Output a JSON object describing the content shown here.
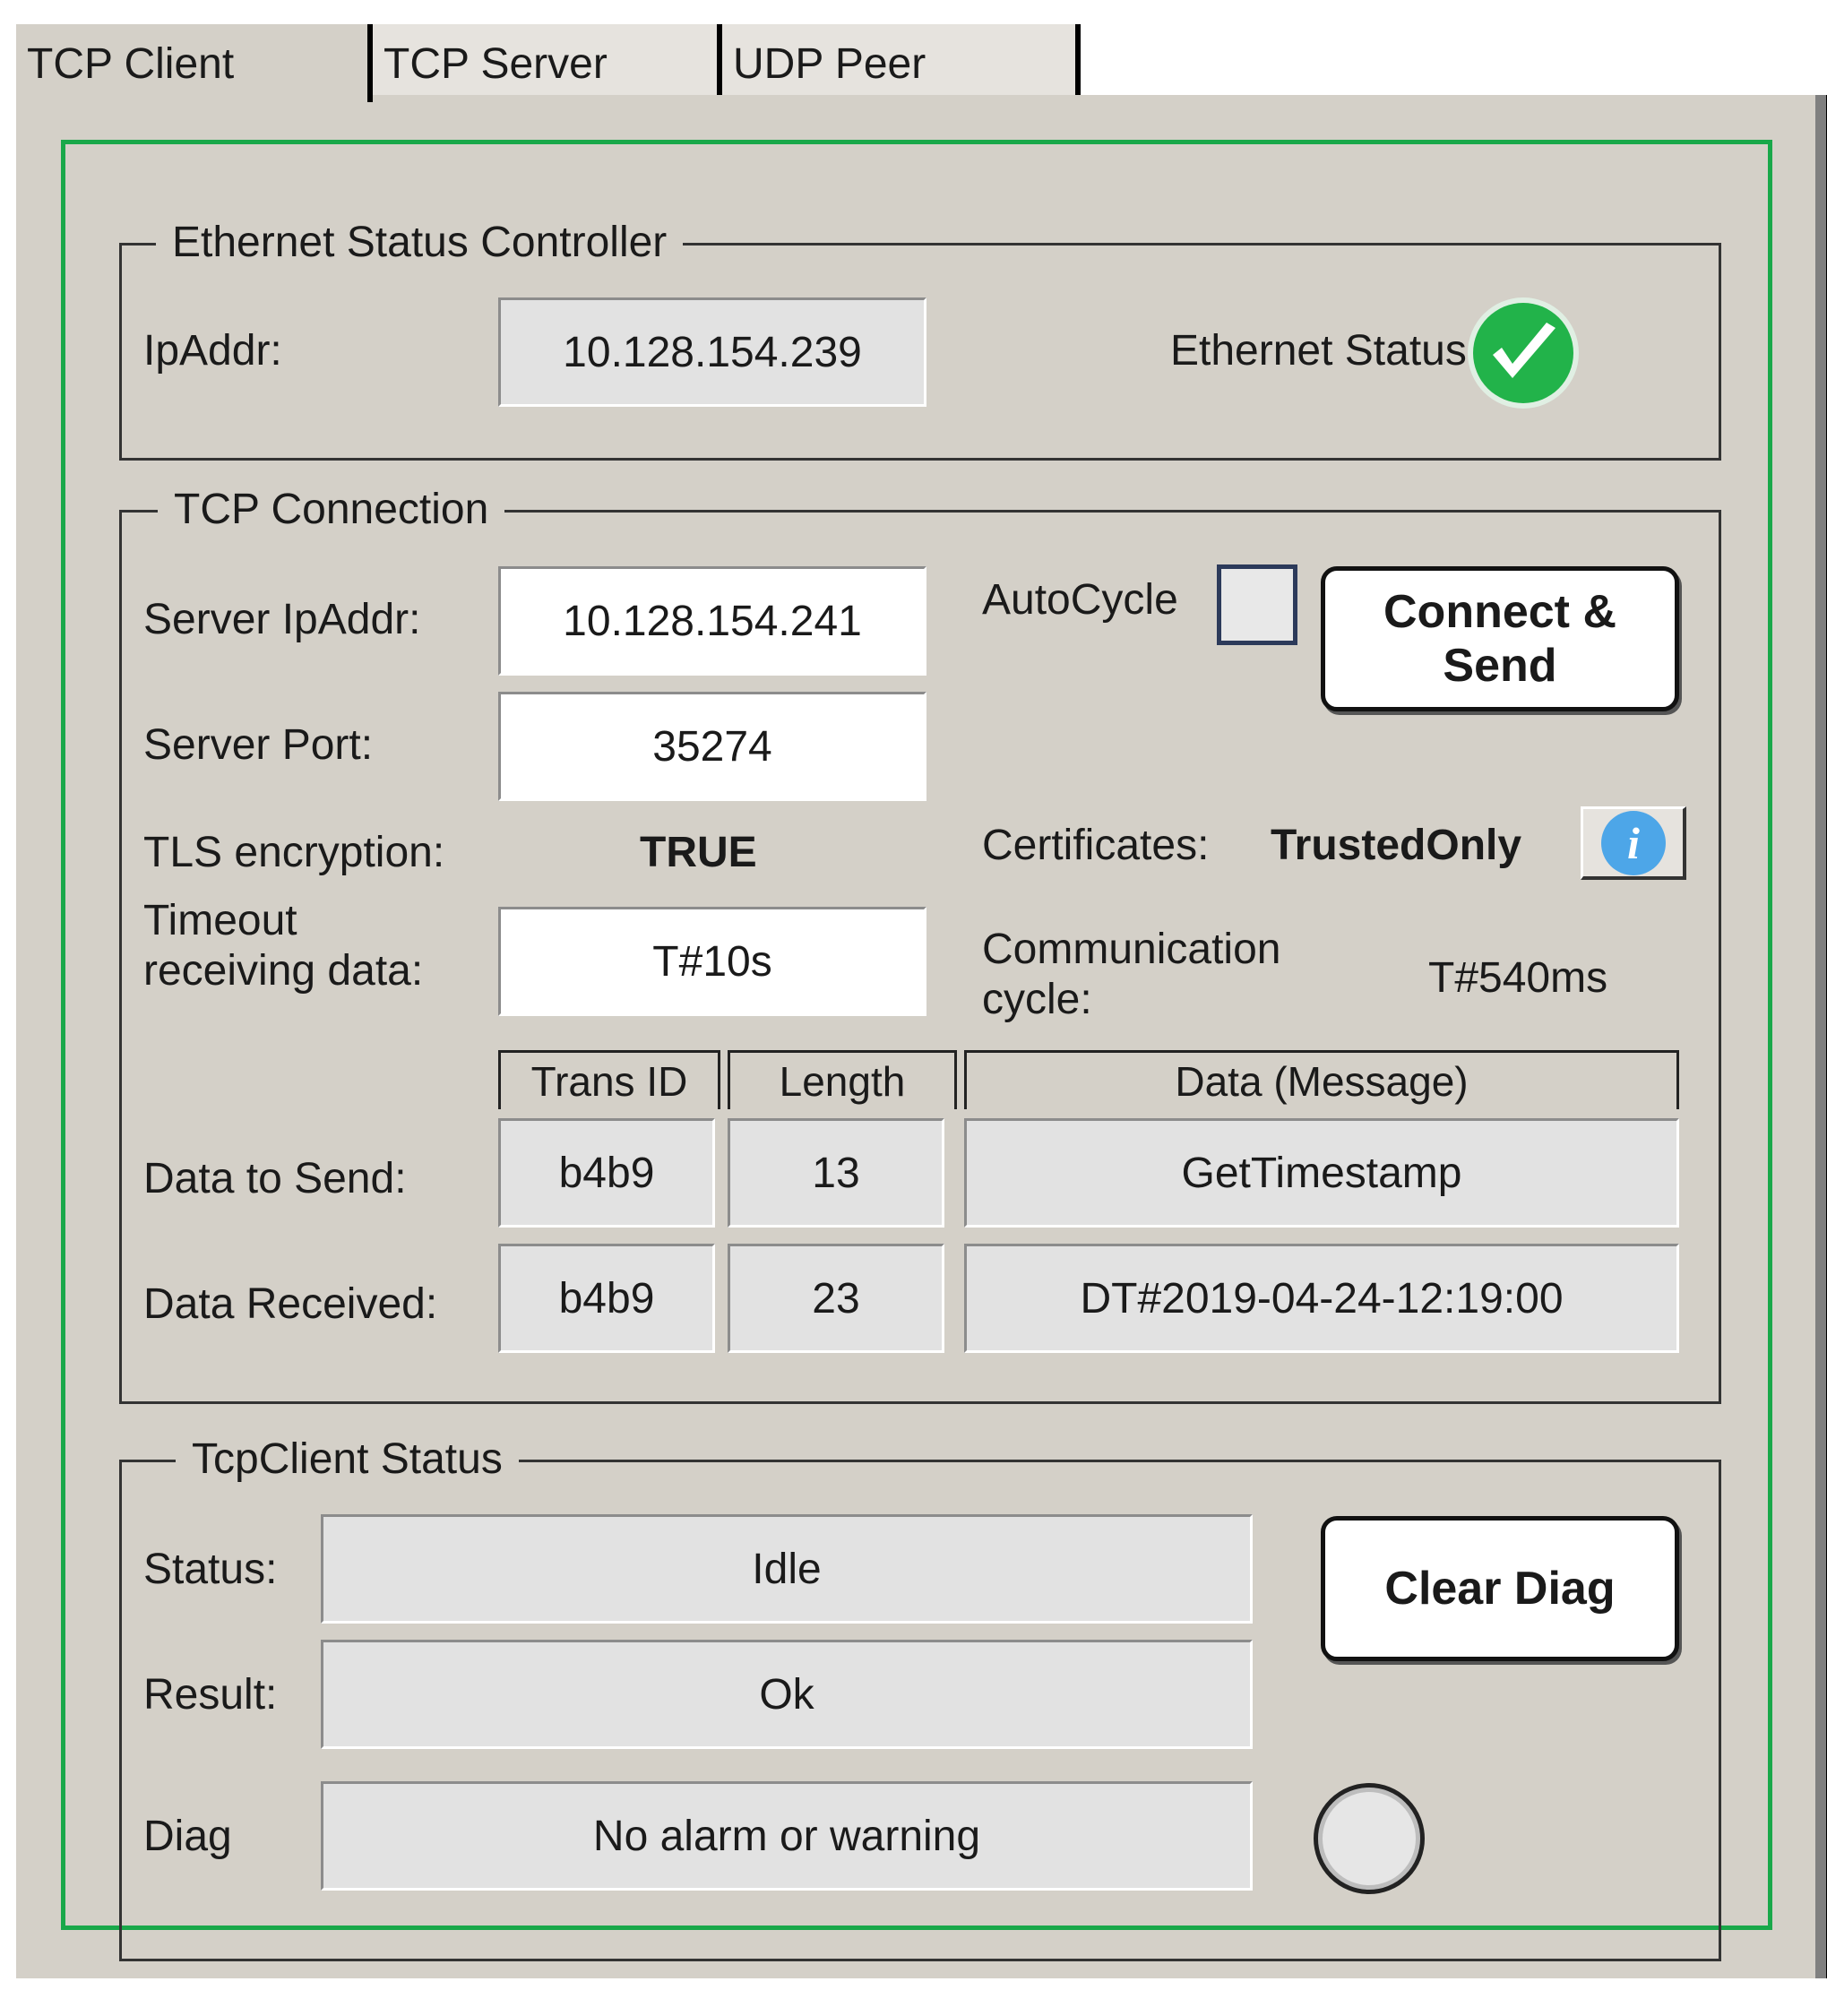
{
  "tabs": [
    {
      "label": "TCP Client",
      "active": true
    },
    {
      "label": "TCP Server",
      "active": false
    },
    {
      "label": "UDP Peer",
      "active": false
    }
  ],
  "colors": {
    "panel_bg": "#d4d0c8",
    "frame_green": "#19a84a",
    "status_ok": "#22b34a",
    "info_blue": "#4da6e8"
  },
  "ethernet_status_controller": {
    "title": "Ethernet Status Controller",
    "ip_label": "IpAddr:",
    "ip_value": "10.128.154.239",
    "status_label": "Ethernet Status:",
    "status_icon": "check-circle-icon"
  },
  "tcp_connection": {
    "title": "TCP Connection",
    "server_ip_label": "Server IpAddr:",
    "server_ip_value": "10.128.154.241",
    "server_port_label": "Server Port:",
    "server_port_value": "35274",
    "autocycle_label": "AutoCycle",
    "autocycle_checked": false,
    "connect_button_line1": "Connect &",
    "connect_button_line2": "Send",
    "tls_label": "TLS encryption:",
    "tls_value": "TRUE",
    "certificates_label": "Certificates:",
    "certificates_value": "TrustedOnly",
    "info_button_glyph": "i",
    "timeout_label_line1": "Timeout",
    "timeout_label_line2": "receiving data:",
    "timeout_value": "T#10s",
    "comm_cycle_label_line1": "Communication",
    "comm_cycle_label_line2": "cycle:",
    "comm_cycle_value": "T#540ms",
    "table": {
      "headers": [
        "Trans ID",
        "Length",
        "Data (Message)"
      ],
      "rows": [
        {
          "label": "Data to Send:",
          "trans_id": "b4b9",
          "length": "13",
          "data": "GetTimestamp"
        },
        {
          "label": "Data Received:",
          "trans_id": "b4b9",
          "length": "23",
          "data": "DT#2019-04-24-12:19:00"
        }
      ]
    }
  },
  "tcpclient_status": {
    "title": "TcpClient Status",
    "status_label": "Status:",
    "status_value": "Idle",
    "result_label": "Result:",
    "result_value": "Ok",
    "diag_label": "Diag",
    "diag_value": "No alarm or warning",
    "clear_button": "Clear Diag",
    "diag_indicator": "off"
  }
}
